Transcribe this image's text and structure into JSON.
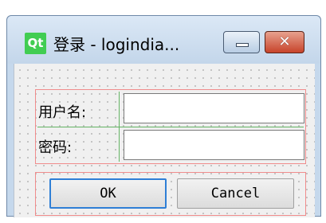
{
  "window": {
    "logo_text": "Qt",
    "title": "登录 - logindia...",
    "minimize_icon": "minimize-icon",
    "close_icon": "close-icon",
    "close_glyph": "✕"
  },
  "form": {
    "username_label": "用户名:",
    "password_label": "密码:",
    "username_value": "",
    "password_value": ""
  },
  "buttons": {
    "ok_label": "OK",
    "cancel_label": "Cancel"
  },
  "colors": {
    "layout_outline": "#f08c8c",
    "form_grid": "#64b464",
    "qt_logo": "#41cd52",
    "close_button": "#c7442b",
    "focus": "#2f7fd6"
  }
}
